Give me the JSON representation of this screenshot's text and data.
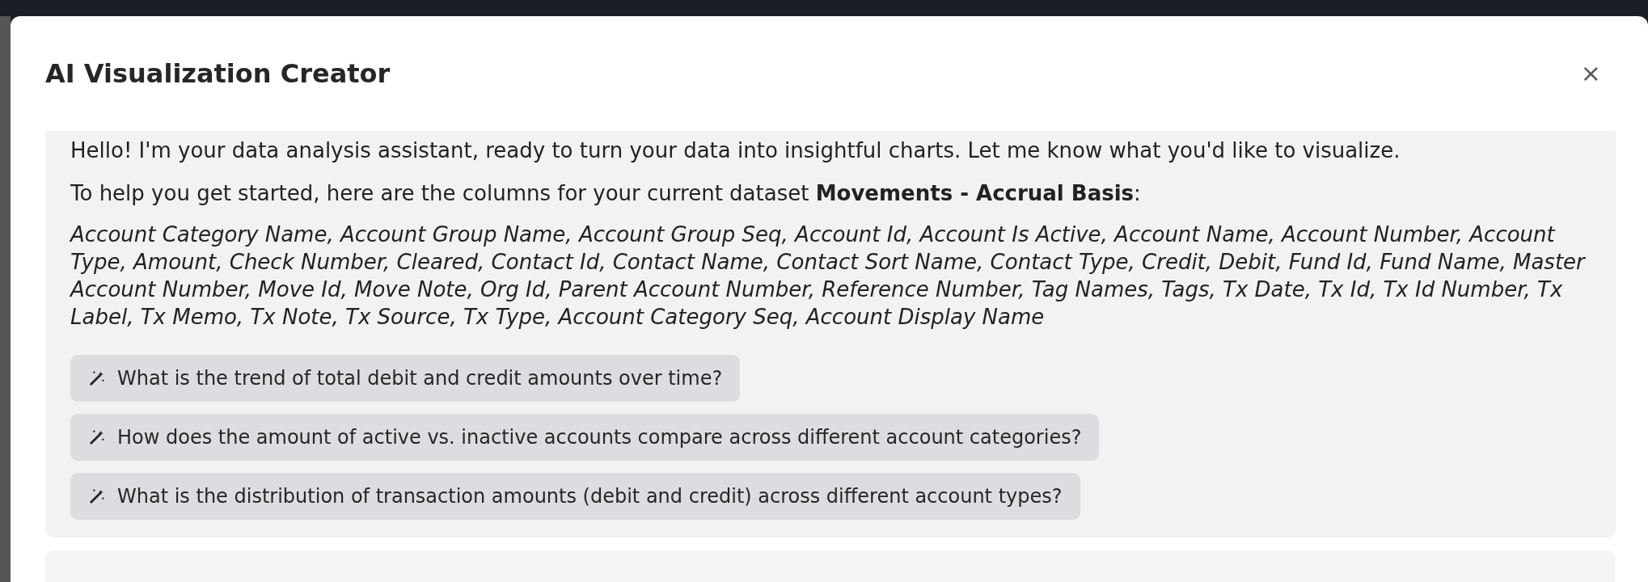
{
  "dialog": {
    "title": "AI Visualization Creator",
    "close_label": "×"
  },
  "message": {
    "greeting": "Hello! I'm your data analysis assistant, ready to turn your data into insightful charts. Let me know what you'd like to visualize.",
    "intro": "To help you get started, here are the columns for your current dataset **Movements - Accrual Basis**:",
    "columns": "Account Category Name, Account Group Name, Account Group Seq, Account Id, Account Is Active, Account Name, Account Number, Account Type, Amount, Check Number, Cleared, Contact Id, Contact Name, Contact Sort Name, Contact Type, Credit, Debit, Fund Id, Fund Name, Master Account Number, Move Id, Move Note, Org Id, Parent Account Number, Reference Number, Tag Names, Tags, Tx Date, Tx Id, Tx Id Number, Tx Label, Tx Memo, Tx Note, Tx Source, Tx Type, Account Category Seq, Account Display Name",
    "suggestions": [
      {
        "label": "What is the trend of total debit and credit amounts over time?"
      },
      {
        "label": "How does the amount of active vs. inactive accounts compare across different account categories?"
      },
      {
        "label": "What is the distribution of transaction amounts (debit and credit) across different account types?"
      }
    ]
  }
}
